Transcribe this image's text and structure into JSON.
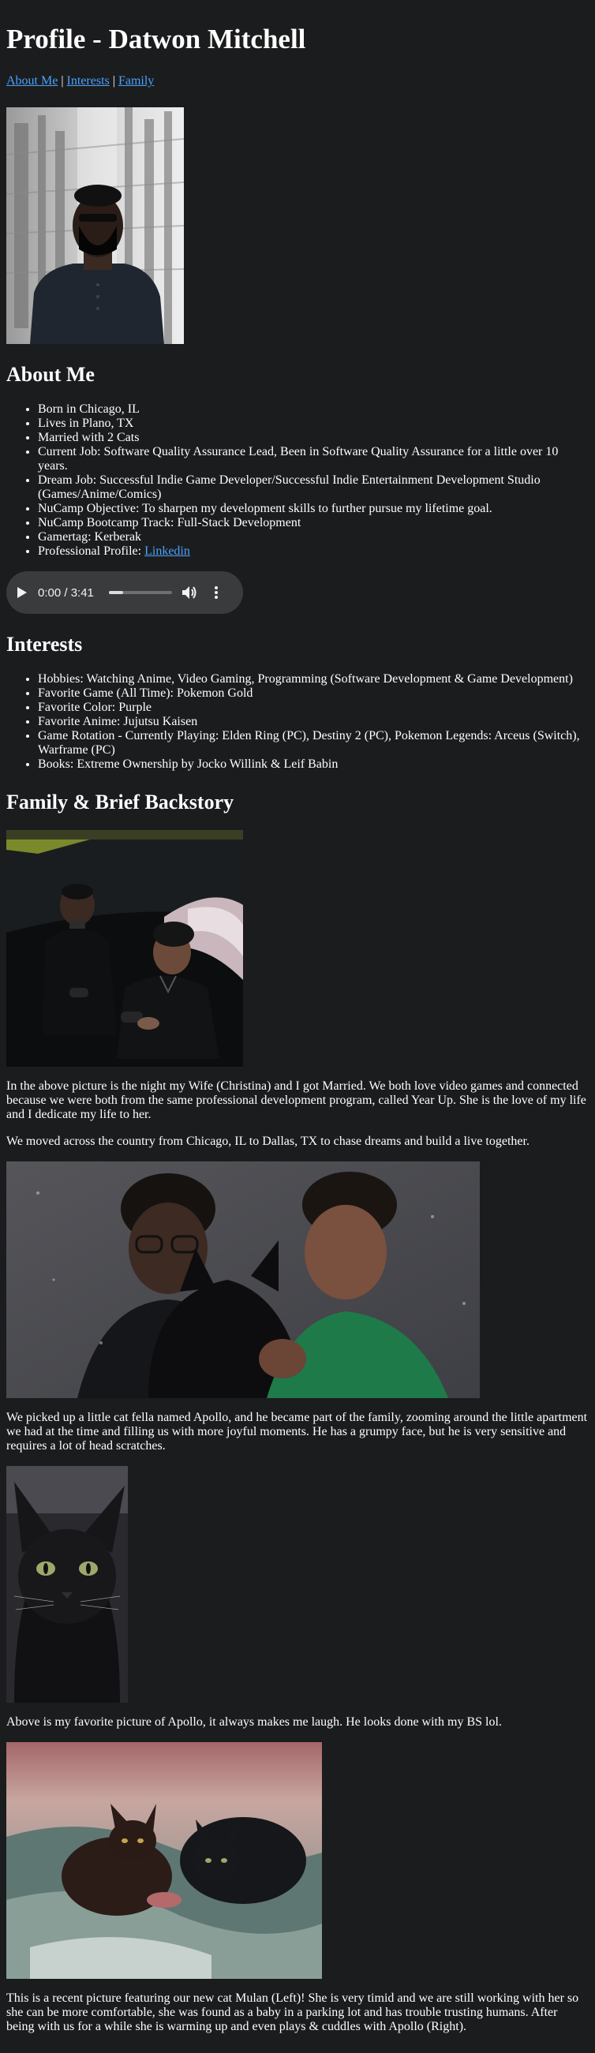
{
  "header": {
    "title": "Profile - Datwon Mitchell"
  },
  "nav": {
    "about": "About Me",
    "interests": "Interests",
    "family": "Family",
    "sep": "|"
  },
  "about": {
    "heading": "About Me",
    "items": [
      "Born in Chicago, IL",
      "Lives in Plano, TX",
      "Married with 2 Cats",
      "Current Job: Software Quality Assurance Lead, Been in Software Quality Assurance for a little over 10 years.",
      "Dream Job: Successful Indie Game Developer/Successful Indie Entertainment Development Studio (Games/Anime/Comics)",
      "NuCamp Objective: To sharpen my development skills to further pursue my lifetime goal.",
      "NuCamp Bootcamp Track: Full-Stack Development",
      "Gamertag: Kerberak"
    ],
    "profile_label": "Professional Profile:",
    "profile_link": "Linkedin"
  },
  "audio": {
    "time": "0:00 / 3:41",
    "progress": 0.22,
    "play_icon": "play-icon",
    "volume_icon": "volume-icon",
    "more_icon": "more-vert-icon"
  },
  "interests": {
    "heading": "Interests",
    "items": [
      "Hobbies: Watching Anime, Video Gaming, Programming (Software Development & Game Development)",
      "Favorite Game (All Time): Pokemon Gold",
      "Favorite Color: Purple",
      "Favorite Anime: Jujutsu Kaisen",
      "Game Rotation - Currently Playing: Elden Ring (PC), Destiny 2 (PC), Pokemon Legends: Arceus (Switch), Warframe (PC)",
      "Books: Extreme Ownership by Jocko Willink & Leif Babin"
    ]
  },
  "family": {
    "heading": "Family & Brief Backstory",
    "p1": "In the above picture is the night my Wife (Christina) and I got Married. We both love video games and connected because we were both from the same professional development program, called Year Up. She is the love of my life and I dedicate my life to her.",
    "p2": "We moved across the country from Chicago, IL to Dallas, TX to chase dreams and build a live together.",
    "p3": "We picked up a little cat fella named Apollo, and he became part of the family, zooming around the little apartment we had at the time and filling us with more joyful moments. He has a grumpy face, but he is very sensitive and requires a lot of head scratches.",
    "p4": "Above is my favorite picture of Apollo, it always makes me laugh. He looks done with my BS lol.",
    "p5": "This is a recent picture featuring our new cat Mulan (Left)! She is very timid and we are still working with her so she can be more comfortable, she was found as a baby in a parking lot and has trouble trusting humans. After being with us for a while she is warming up and even plays & cuddles with Apollo (Right)."
  }
}
